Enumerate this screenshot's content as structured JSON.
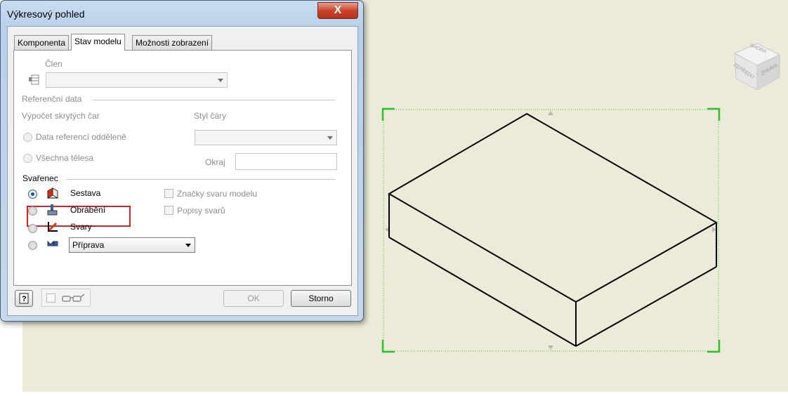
{
  "dialog": {
    "title": "Výkresový pohled",
    "close_label": "X",
    "tabs": [
      {
        "label": "Komponenta"
      },
      {
        "label": "Stav modelu"
      },
      {
        "label": "Možnosti zobrazení"
      }
    ],
    "member": {
      "label": "Člen",
      "value": ""
    },
    "reference": {
      "section_label": "Referenční data",
      "hidden_lines_label": "Výpočet skrytých čar",
      "option_separate": "Data referencí odděleně",
      "option_all_bodies": "Všechna tělesa",
      "line_style_label": "Styl čáry",
      "line_style_value": "",
      "margin_label": "Okraj",
      "margin_value": ""
    },
    "weldment": {
      "section_label": "Svařenec",
      "options": [
        {
          "label": "Sestava",
          "selected": true,
          "icon": "assembly-icon"
        },
        {
          "label": "Obrábění",
          "selected": false,
          "icon": "machining-icon"
        },
        {
          "label": "Svary",
          "selected": false,
          "icon": "welds-icon"
        },
        {
          "label": "",
          "selected": false,
          "icon": "preparation-icon"
        }
      ],
      "preparation_value": "Příprava",
      "weld_symbols_label": "Značky svaru modelu",
      "weld_annotations_label": "Popisy svarů"
    },
    "footer": {
      "help_icon": "help-icon",
      "preview_icon": "glasses-icon",
      "ok_label": "OK",
      "cancel_label": "Storno"
    }
  },
  "viewcube": {
    "top_label": "SHORA",
    "front_label": "ZEPŘEDU",
    "right_label": "ZPRAVA"
  },
  "colors": {
    "sheet_background": "#ecebd9",
    "selection_green": "#2ec02e",
    "highlight_red": "#e02020",
    "selected_radio": "#1e4f9c"
  }
}
